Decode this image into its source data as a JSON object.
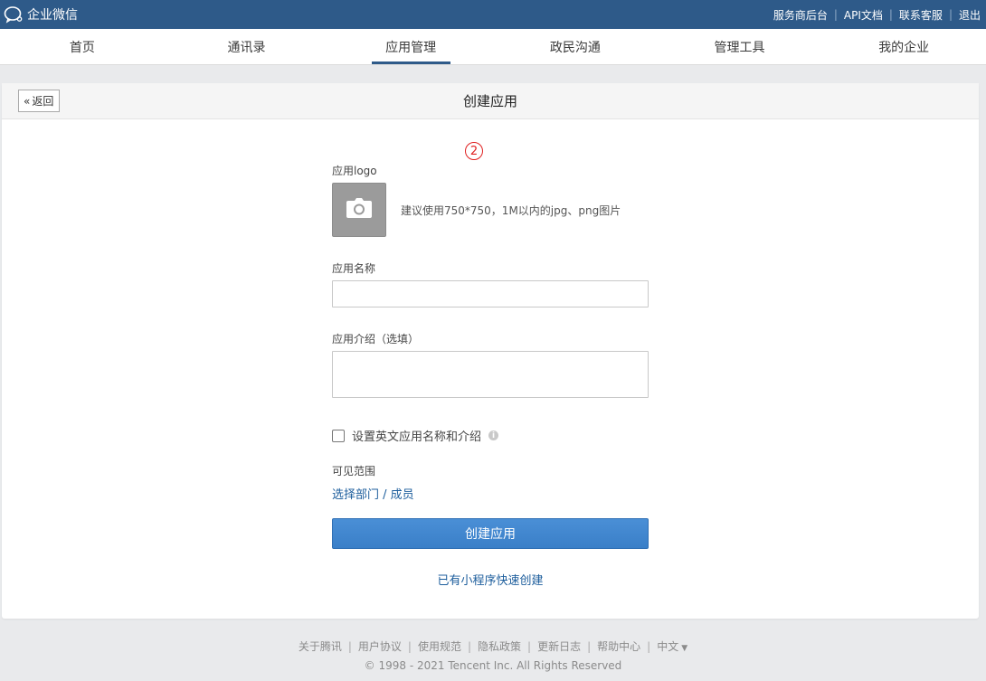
{
  "topbar": {
    "brand": "企业微信",
    "links": [
      "服务商后台",
      "API文档",
      "联系客服",
      "退出"
    ]
  },
  "nav": {
    "tabs": [
      {
        "label": "首页"
      },
      {
        "label": "通讯录"
      },
      {
        "label": "应用管理",
        "active": true
      },
      {
        "label": "政民沟通"
      },
      {
        "label": "管理工具"
      },
      {
        "label": "我的企业"
      }
    ]
  },
  "panel": {
    "back_label": "返回",
    "title": "创建应用",
    "step_marker": "2"
  },
  "form": {
    "logo_label": "应用logo",
    "logo_hint": "建议使用750*750，1M以内的jpg、png图片",
    "name_label": "应用名称",
    "name_value": "",
    "intro_label": "应用介绍（选填）",
    "intro_value": "",
    "english_checkbox_label": "设置英文应用名称和介绍",
    "english_checked": false,
    "scope_label": "可见范围",
    "scope_link": "选择部门 / 成员",
    "submit_label": "创建应用",
    "quick_create_link": "已有小程序快速创建"
  },
  "footer": {
    "links": [
      "关于腾讯",
      "用户协议",
      "使用规范",
      "隐私政策",
      "更新日志",
      "帮助中心"
    ],
    "language": "中文",
    "copyright": "© 1998 - 2021 Tencent Inc. All Rights Reserved"
  },
  "colors": {
    "topbar": "#2e5a89",
    "primary": "#3a7fc8",
    "link": "#1c5d9c",
    "marker": "#e02020"
  }
}
